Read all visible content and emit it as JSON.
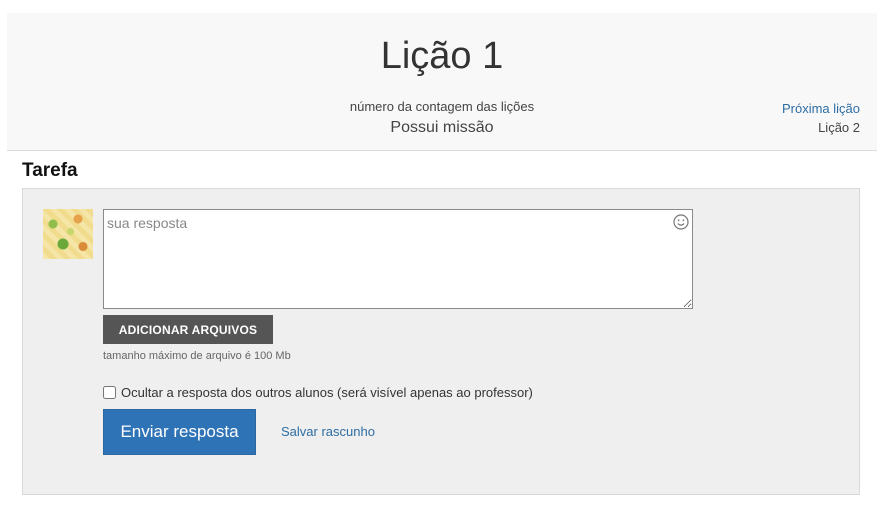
{
  "header": {
    "title": "Lição 1",
    "counter_label": "número da contagem das lições",
    "mission": "Possui missão",
    "next_link": "Próxima lição",
    "next_lesson": "Lição 2"
  },
  "task": {
    "section_title": "Tarefa",
    "answer_placeholder": "sua resposta",
    "emoji_icon": "smiley-icon",
    "add_files_label": "ADICIONAR ARQUIVOS",
    "file_hint": "tamanho máximo de arquivo é 100 Mb",
    "hide_checkbox_label": "Ocultar a resposta dos outros alunos (será visível apenas ao professor)",
    "hide_checked": false,
    "submit_label": "Enviar resposta",
    "draft_label": "Salvar rascunho"
  },
  "colors": {
    "accent": "#2f73b7",
    "link": "#2e6da4",
    "dark_button": "#555555",
    "panel_bg": "#efefef",
    "header_bg": "#f8f8f8"
  }
}
